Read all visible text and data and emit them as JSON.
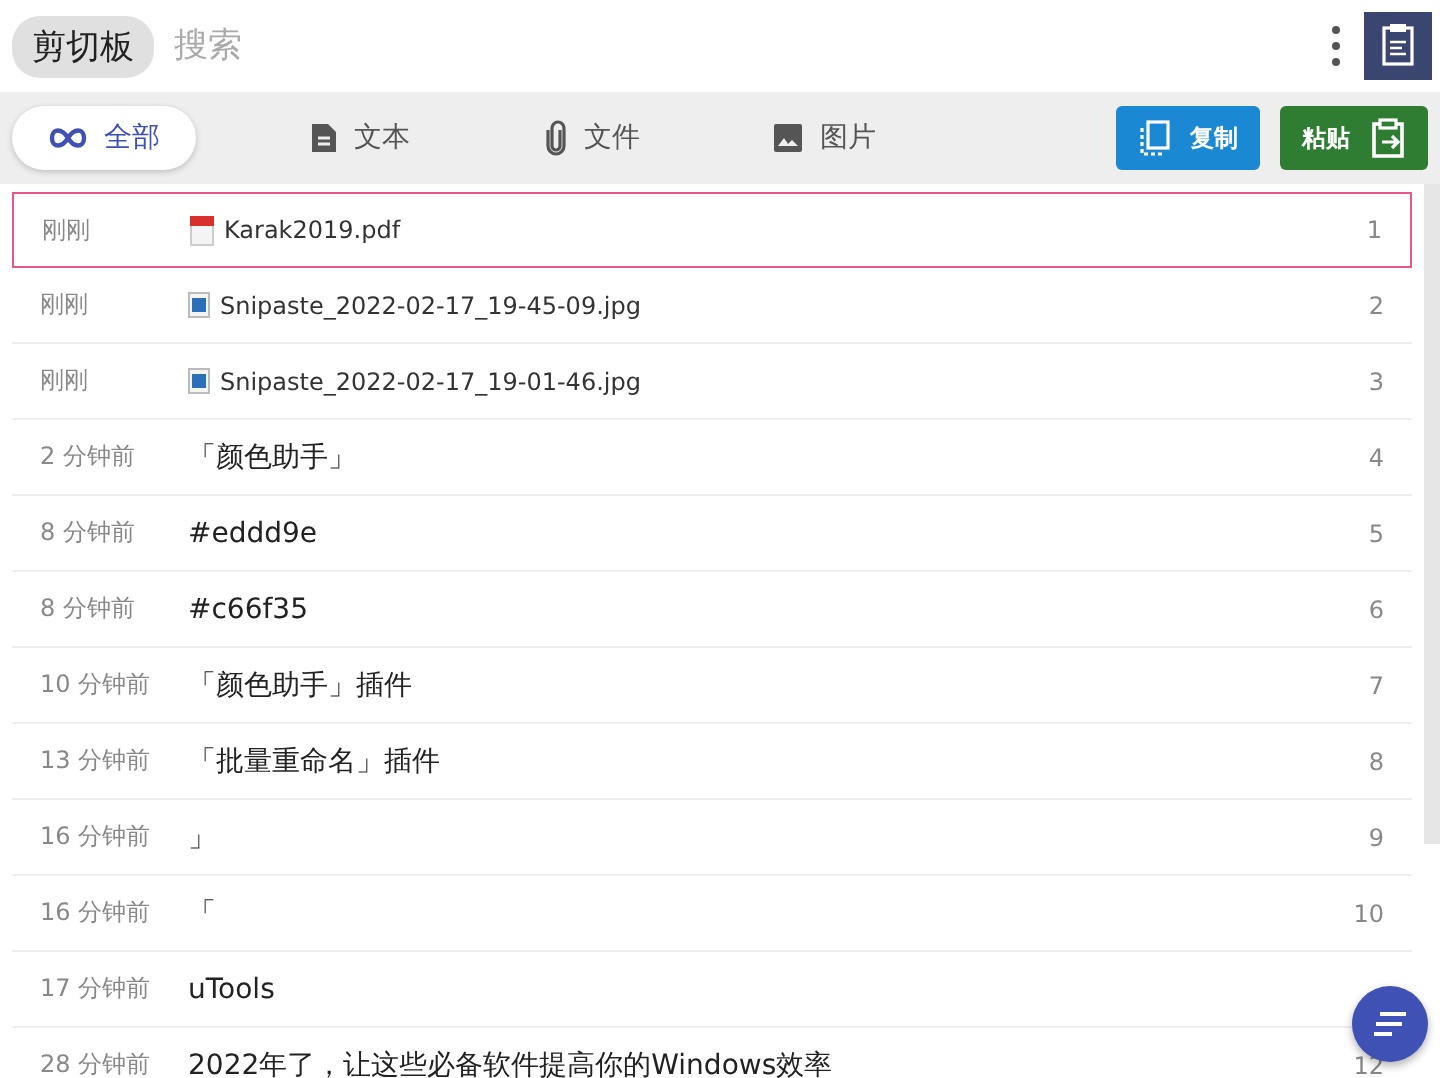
{
  "header": {
    "title": "剪切板",
    "search": {
      "placeholder": "搜索"
    }
  },
  "filters": [
    {
      "label": "全部",
      "selected": true
    },
    {
      "label": "文本",
      "selected": false
    },
    {
      "label": "文件",
      "selected": false
    },
    {
      "label": "图片",
      "selected": false
    }
  ],
  "actions": [
    {
      "label": "复制",
      "kind": "copy"
    },
    {
      "label": "粘贴",
      "kind": "paste"
    }
  ],
  "items": [
    {
      "time": "刚刚",
      "kind": "pdf",
      "content": "Karak2019.pdf",
      "index": "1",
      "selected": true
    },
    {
      "time": "刚刚",
      "kind": "image",
      "content": "Snipaste_2022-02-17_19-45-09.jpg",
      "index": "2",
      "selected": false
    },
    {
      "time": "刚刚",
      "kind": "image",
      "content": "Snipaste_2022-02-17_19-01-46.jpg",
      "index": "3",
      "selected": false
    },
    {
      "time": "2 分钟前",
      "kind": "text",
      "content": "「颜色助手」",
      "index": "4",
      "selected": false
    },
    {
      "time": "8 分钟前",
      "kind": "text",
      "content": "#eddd9e",
      "index": "5",
      "selected": false
    },
    {
      "time": "8 分钟前",
      "kind": "text",
      "content": "#c66f35",
      "index": "6",
      "selected": false
    },
    {
      "time": "10 分钟前",
      "kind": "text",
      "content": "「颜色助手」插件",
      "index": "7",
      "selected": false
    },
    {
      "time": "13 分钟前",
      "kind": "text",
      "content": "「批量重命名」插件",
      "index": "8",
      "selected": false
    },
    {
      "time": "16 分钟前",
      "kind": "text",
      "content": "」",
      "index": "9",
      "selected": false
    },
    {
      "time": "16 分钟前",
      "kind": "text",
      "content": "「",
      "index": "10",
      "selected": false
    },
    {
      "time": "17 分钟前",
      "kind": "text",
      "content": "uTools",
      "selected": false
    },
    {
      "time": "28 分钟前",
      "kind": "text",
      "content": "2022年了，让这些必备软件提高你的Windows效率",
      "index": "12",
      "selected": false
    }
  ]
}
